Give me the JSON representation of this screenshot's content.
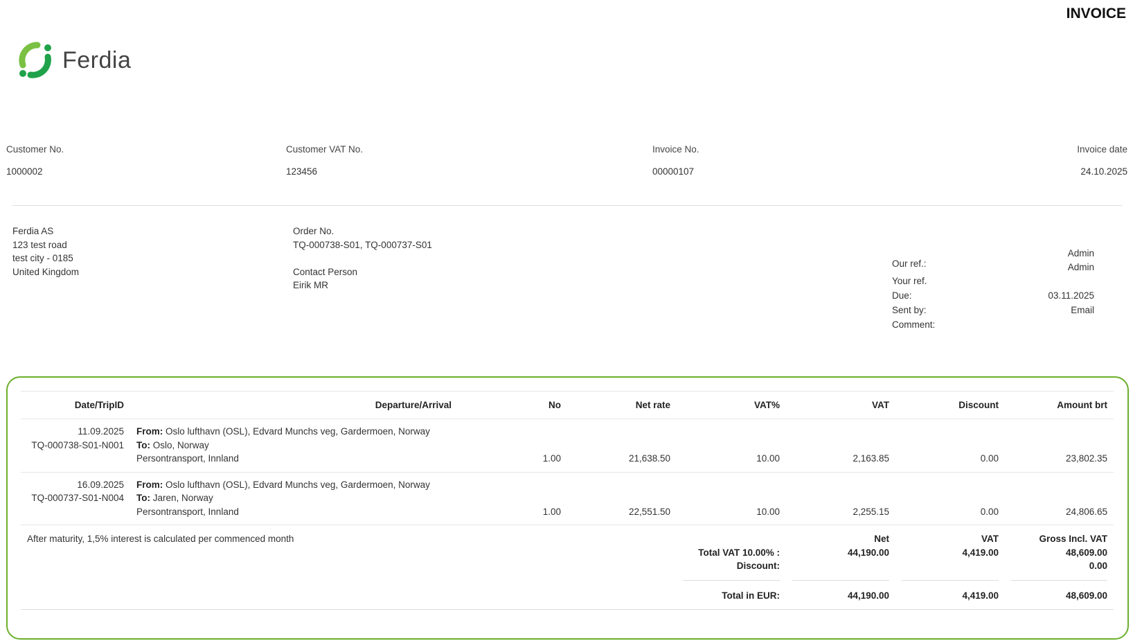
{
  "title": "INVOICE",
  "logo": {
    "text": "Ferdia"
  },
  "meta": [
    {
      "label": "Customer No.",
      "value": "1000002"
    },
    {
      "label": "Customer VAT No.",
      "value": "123456"
    },
    {
      "label": "Invoice No.",
      "value": "00000107"
    },
    {
      "label": "Invoice date",
      "value": "24.10.2025"
    }
  ],
  "address": [
    "Ferdia AS",
    "123 test road",
    "test city - 0185",
    "United Kingdom"
  ],
  "order": {
    "order_label": "Order No.",
    "order_value": "TQ-000738-S01, TQ-000737-S01",
    "contact_label": "Contact Person",
    "contact_value": "Eirik MR"
  },
  "refs": {
    "our_ref_label": "Our ref.:",
    "our_ref_values": [
      "Admin",
      "Admin"
    ],
    "your_ref_label": "Your ref.",
    "due_label": "Due:",
    "due_value": "03.11.2025",
    "sent_label": "Sent by:",
    "sent_value": "Email",
    "comment_label": "Comment:"
  },
  "table": {
    "headers": [
      "Date/TripID",
      "Departure/Arrival",
      "No",
      "Net rate",
      "VAT%",
      "VAT",
      "Discount",
      "Amount brt"
    ],
    "rows": [
      {
        "date": "11.09.2025",
        "trip": "TQ-000738-S01-N001",
        "from_label": "From:",
        "from": "Oslo lufthavn (OSL), Edvard Munchs veg, Gardermoen, Norway",
        "to_label": "To:",
        "to": "Oslo, Norway",
        "service": "Persontransport, Innland",
        "no": "1.00",
        "net": "21,638.50",
        "vatp": "10.00",
        "vat": "2,163.85",
        "disc": "0.00",
        "amount": "23,802.35"
      },
      {
        "date": "16.09.2025",
        "trip": "TQ-000737-S01-N004",
        "from_label": "From:",
        "from": "Oslo lufthavn (OSL), Edvard Munchs veg, Gardermoen, Norway",
        "to_label": "To:",
        "to": "Jaren, Norway",
        "service": "Persontransport, Innland",
        "no": "1.00",
        "net": "22,551.50",
        "vatp": "10.00",
        "vat": "2,255.15",
        "disc": "0.00",
        "amount": "24,806.65"
      }
    ]
  },
  "summary": {
    "note": "After maturity, 1,5% interest is calculated per commenced month",
    "net_h": "Net",
    "vat_h": "VAT",
    "gross_h": "Gross Incl. VAT",
    "total_vat_label": "Total VAT 10.00% :",
    "net": "44,190.00",
    "vat": "4,419.00",
    "gross": "48,609.00",
    "discount_label": "Discount:",
    "discount": "0.00",
    "total_label": "Total in EUR:",
    "total_net": "44,190.00",
    "total_vat": "4,419.00",
    "total_gross": "48,609.00"
  }
}
